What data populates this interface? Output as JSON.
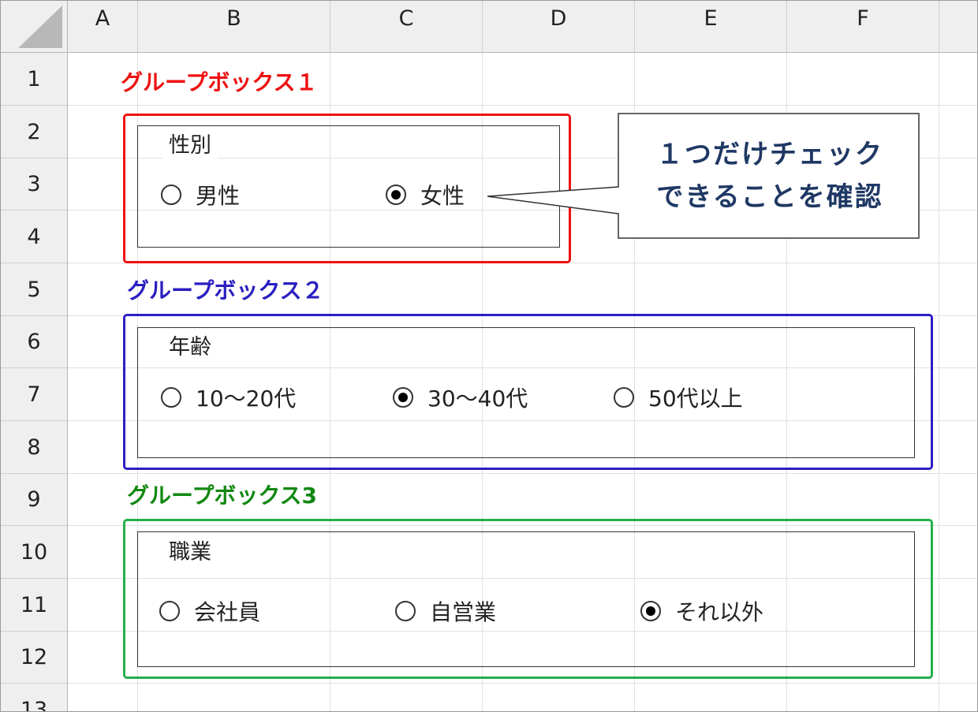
{
  "sheet": {
    "columns": [
      "A",
      "B",
      "C",
      "D",
      "E",
      "F"
    ],
    "rows": [
      "1",
      "2",
      "3",
      "4",
      "5",
      "6",
      "7",
      "8",
      "9",
      "10",
      "11",
      "12",
      "13"
    ]
  },
  "groups": [
    {
      "title": "グループボックス１",
      "color": "#ee1111",
      "caption": "性別",
      "options": [
        {
          "label": "男性",
          "selected": false
        },
        {
          "label": "女性",
          "selected": true
        }
      ]
    },
    {
      "title": "グループボックス２",
      "color": "#2a1fc0",
      "caption": "年齢",
      "options": [
        {
          "label": "10～20代",
          "selected": false
        },
        {
          "label": "30～40代",
          "selected": true
        },
        {
          "label": "50代以上",
          "selected": false
        }
      ]
    },
    {
      "title": "グループボックス3",
      "color": "#118811",
      "caption": "職業",
      "options": [
        {
          "label": "会社員",
          "selected": false
        },
        {
          "label": "自営業",
          "selected": false
        },
        {
          "label": "それ以外",
          "selected": true
        }
      ]
    }
  ],
  "frame_colors": [
    "#ee1111",
    "#2a1fc0",
    "#22b04c"
  ],
  "callout": {
    "line1": "１つだけチェック",
    "line2": "できることを確認",
    "text_color": "#1f3864"
  }
}
